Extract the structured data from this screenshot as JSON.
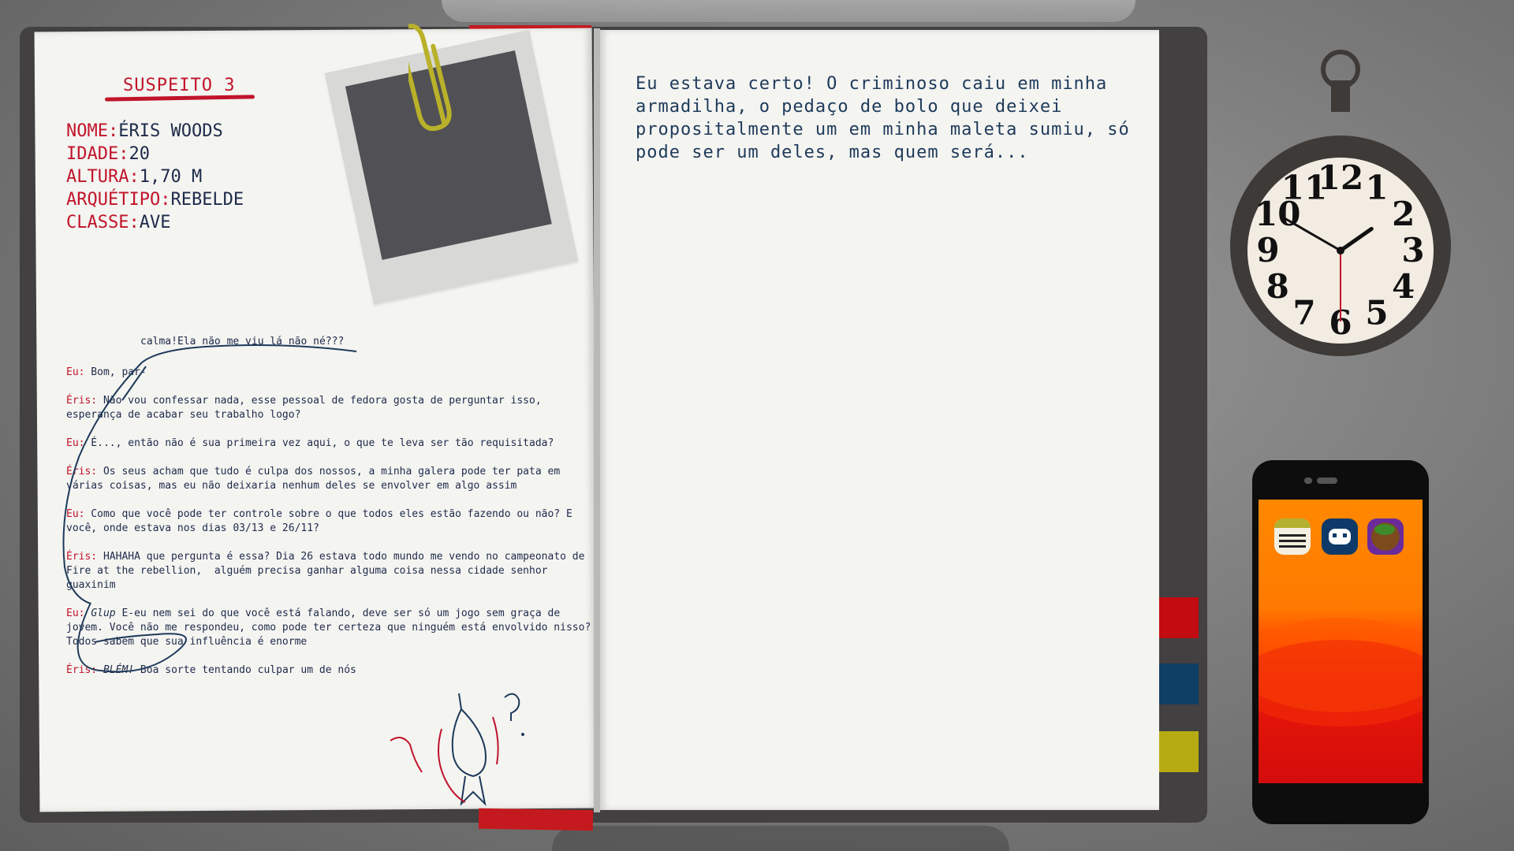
{
  "suspect": {
    "title": "SUSPEITO 3",
    "fields": [
      {
        "key": "NOME:",
        "value": "ÉRIS WOODS"
      },
      {
        "key": "IDADE:",
        "value": "20"
      },
      {
        "key": "ALTURA:",
        "value": "1,70 M"
      },
      {
        "key": "ARQUÉTIPO:",
        "value": "REBELDE"
      },
      {
        "key": "CLASSE:",
        "value": "AVE"
      }
    ]
  },
  "note": "calma!Ela não me viu lá não né???",
  "transcript": [
    {
      "speaker": "Eu:",
      "text": " Bom, par-"
    },
    {
      "speaker": "Éris:",
      "text": " Não vou confessar nada, esse pessoal de fedora gosta de perguntar isso, esperança de acabar seu trabalho logo?"
    },
    {
      "speaker": "Eu:",
      "text": " É..., então não é sua primeira vez aqui, o que te leva ser tão requisitada?"
    },
    {
      "speaker": "Éris:",
      "text": " Os seus acham que tudo é culpa dos nossos, a minha galera pode ter pata em várias coisas, mas eu não deixaria nenhum deles se envolver em algo assim"
    },
    {
      "speaker": "Eu:",
      "text": " Como que você pode ter controle sobre o que todos eles estão fazendo ou não? E você, onde estava nos dias 03/13 e 26/11?"
    },
    {
      "speaker": "Éris:",
      "text": " HAHAHA que pergunta é essa? Dia 26 estava todo mundo me vendo no campeonato de Fire at the rebellion,  alguém precisa ganhar alguma coisa nessa cidade senhor guaxinim"
    },
    {
      "speaker": "Eu:",
      "emph": "Glup",
      "text": " E-eu nem sei do que você está falando, deve ser só um jogo sem graça de jovem. Você não me respondeu, como pode ter certeza que ninguém está envolvido nisso? Todos sabem que sua influência é enorme"
    },
    {
      "speaker": "Éris:",
      "emph": "BLÉM!",
      "text": " Boa sorte tentando culpar um de nós"
    }
  ],
  "journal": "Eu estava certo! O criminoso caiu em minha armadilha, o pedaço de bolo que deixei propositalmente um em minha maleta sumiu, só pode ser um deles, mas quem será...",
  "clock": {
    "numerals": [
      "12",
      "1",
      "2",
      "3",
      "4",
      "5",
      "6",
      "7",
      "8",
      "9",
      "10",
      "11"
    ],
    "time": "1:50:30"
  },
  "phone": {
    "apps": [
      "notes-app-icon",
      "cat-face-app-icon",
      "globe-app-icon"
    ]
  },
  "colors": {
    "accent_red": "#c0142a",
    "ink_blue": "#1e2a4a",
    "tab_red": "#c20c12",
    "tab_blue": "#0f3f64",
    "tab_olive": "#b6ab13"
  }
}
